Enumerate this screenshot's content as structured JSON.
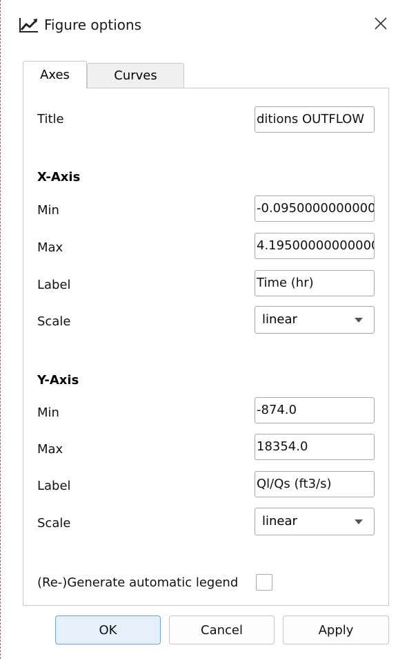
{
  "window": {
    "title": "Figure options",
    "icon": "chart-line-icon",
    "close_icon": "close-icon"
  },
  "tabs": [
    {
      "label": "Axes",
      "active": true
    },
    {
      "label": "Curves",
      "active": false
    }
  ],
  "axes": {
    "title_label": "Title",
    "title_value": "ditions OUTFLOW",
    "x_axis": {
      "heading": "X-Axis",
      "min_label": "Min",
      "min_value": "-0.0950000000000",
      "max_label": "Max",
      "max_value": "4.19500000000000",
      "label_label": "Label",
      "label_value": "Time (hr)",
      "scale_label": "Scale",
      "scale_value": "linear"
    },
    "y_axis": {
      "heading": "Y-Axis",
      "min_label": "Min",
      "min_value": "-874.0",
      "max_label": "Max",
      "max_value": "18354.0",
      "label_label": "Label",
      "label_value": "Ql/Qs (ft3/s)",
      "scale_label": "Scale",
      "scale_value": "linear"
    },
    "legend_label": "(Re-)Generate automatic legend",
    "legend_checked": false
  },
  "buttons": {
    "ok": "OK",
    "cancel": "Cancel",
    "apply": "Apply"
  },
  "colors": {
    "accent": "#6aa5de",
    "default_button_bg": "#e6f0fb"
  }
}
